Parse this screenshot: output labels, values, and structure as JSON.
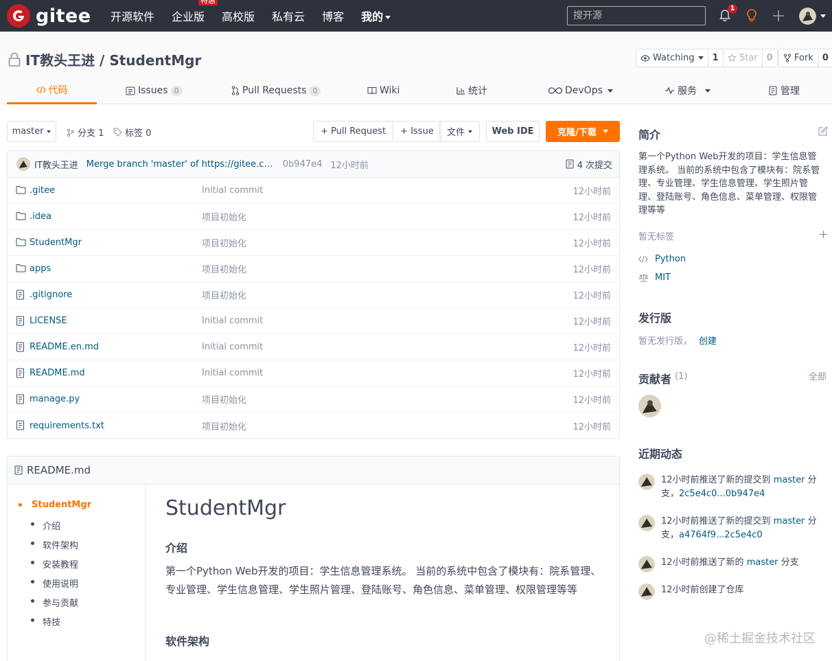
{
  "header": {
    "logo_text": "gitee",
    "nav": [
      {
        "label": "开源软件"
      },
      {
        "label": "企业版",
        "badge": "特惠"
      },
      {
        "label": "高校版"
      },
      {
        "label": "私有云"
      },
      {
        "label": "博客"
      },
      {
        "label": "我的"
      }
    ],
    "search_placeholder": "搜开源",
    "notification_count": "1",
    "icons": [
      "bell-icon",
      "lightbulb-icon",
      "plus-icon",
      "avatar"
    ]
  },
  "repo": {
    "title": "IT教头王进 / StudentMgr",
    "watch": {
      "label": "Watching",
      "count": "1"
    },
    "star": {
      "label": "Star",
      "count": "0"
    },
    "fork": {
      "label": "Fork",
      "count": "0"
    }
  },
  "tabs": [
    {
      "label": "代码",
      "icon": "code-icon",
      "active": true
    },
    {
      "label": "Issues",
      "count": "0",
      "icon": "issues-icon"
    },
    {
      "label": "Pull Requests",
      "count": "0",
      "icon": "pull-request-icon"
    },
    {
      "label": "Wiki",
      "icon": "book-icon"
    },
    {
      "label": "统计",
      "icon": "chart-icon"
    },
    {
      "label": "DevOps",
      "icon": "infinity-icon"
    },
    {
      "label": "服务",
      "icon": "pulse-icon"
    },
    {
      "label": "管理",
      "icon": "manage-icon"
    }
  ],
  "toolbar": {
    "branch": "master",
    "branches": "分支 1",
    "tags": "标签 0",
    "pull_request": "+ Pull Request",
    "issue": "+ Issue",
    "file": "文件",
    "web_ide": "Web IDE",
    "clone": "克隆/下载"
  },
  "last_commit": {
    "author": "IT教头王进",
    "message": "Merge branch 'master' of https://gitee.com...",
    "sha": "0b947e4",
    "time": "12小时前",
    "commits": "4 次提交"
  },
  "files": [
    {
      "name": ".gitee",
      "type": "folder",
      "message": "Initial commit",
      "time": "12小时前"
    },
    {
      "name": ".idea",
      "type": "folder",
      "message": "项目初始化",
      "time": "12小时前"
    },
    {
      "name": "StudentMgr",
      "type": "folder",
      "message": "项目初始化",
      "time": "12小时前"
    },
    {
      "name": "apps",
      "type": "folder",
      "message": "项目初始化",
      "time": "12小时前"
    },
    {
      "name": ".gitignore",
      "type": "file",
      "message": "项目初始化",
      "time": "12小时前"
    },
    {
      "name": "LICENSE",
      "type": "file",
      "message": "Initial commit",
      "time": "12小时前"
    },
    {
      "name": "README.en.md",
      "type": "file",
      "message": "Initial commit",
      "time": "12小时前"
    },
    {
      "name": "README.md",
      "type": "file",
      "message": "Initial commit",
      "time": "12小时前"
    },
    {
      "name": "manage.py",
      "type": "file",
      "message": "项目初始化",
      "time": "12小时前"
    },
    {
      "name": "requirements.txt",
      "type": "file",
      "message": "项目初始化",
      "time": "12小时前"
    }
  ],
  "readme": {
    "filename": "README.md",
    "toc": [
      "StudentMgr",
      "介绍",
      "软件架构",
      "安装教程",
      "使用说明",
      "参与贡献",
      "特技"
    ],
    "h1": "StudentMgr",
    "intro_heading": "介绍",
    "intro_text": "第一个Python Web开发的项目：学生信息管理系统。 当前的系统中包含了模块有：院系管理、专业管理、学生信息管理、学生照片管理、登陆账号、角色信息、菜单管理、权限管理等等",
    "arch_heading": "软件架构"
  },
  "sidebar": {
    "intro_title": "简介",
    "intro_text": "第一个Python Web开发的项目：学生信息管理系统。 当前的系统中包含了模块有：院系管理、专业管理、学生信息管理、学生照片管理、登陆账号、角色信息、菜单管理、权限管理等等",
    "no_tags": "暂无标签",
    "language": "Python",
    "license": "MIT",
    "release_title": "发行版",
    "no_release": "暂无发行版，",
    "create": "创建",
    "contributors_title": "贡献者",
    "contributors_count": "(1)",
    "all": "全部",
    "activity_title": "近期动态",
    "activity": [
      {
        "pre": "12小时前推送了新的提交到 ",
        "branch": "master",
        "post": " 分支，",
        "range": "2c5e4c0...0b947e4"
      },
      {
        "pre": "12小时前推送了新的提交到 ",
        "branch": "master",
        "post": " 分支，",
        "range": "a4764f9...2c5e4c0"
      },
      {
        "pre": "12小时前推送了新的 ",
        "branch": "master",
        "post": " 分支",
        "range": ""
      },
      {
        "pre": "12小时前创建了仓库",
        "branch": "",
        "post": "",
        "range": ""
      }
    ]
  },
  "watermark": "@稀土掘金技术社区",
  "colors": {
    "accent": "#fe7300",
    "topbar": "#2e323d",
    "link": "#005980",
    "brand_red": "#c71d23"
  }
}
